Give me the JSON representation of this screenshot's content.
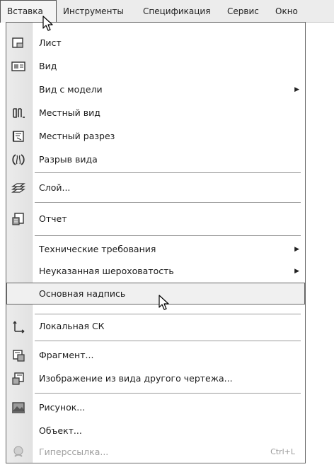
{
  "menubar": {
    "items": [
      {
        "label": "Вставка"
      },
      {
        "label": "Инструменты"
      },
      {
        "label": "Спецификация"
      },
      {
        "label": "Сервис"
      },
      {
        "label": "Окно"
      }
    ]
  },
  "menu": {
    "items": [
      {
        "label": "Лист",
        "icon": "sheet-icon"
      },
      {
        "label": "Вид",
        "icon": "view-icon"
      },
      {
        "label": "Вид с модели",
        "submenu": true
      },
      {
        "label": "Местный вид",
        "icon": "local-view-icon"
      },
      {
        "label": "Местный разрез",
        "icon": "local-section-icon"
      },
      {
        "label": "Разрыв вида",
        "icon": "view-break-icon"
      },
      {
        "label": "Слой...",
        "icon": "layer-icon"
      },
      {
        "label": "Отчет",
        "icon": "report-icon"
      },
      {
        "label": "Технические требования",
        "submenu": true
      },
      {
        "label": "Неуказанная шероховатость",
        "submenu": true
      },
      {
        "label": "Основная надпись"
      },
      {
        "label": "Локальная СК",
        "icon": "local-cs-icon"
      },
      {
        "label": "Фрагмент...",
        "icon": "fragment-icon"
      },
      {
        "label": "Изображение из вида другого чертежа...",
        "icon": "image-from-view-icon"
      },
      {
        "label": "Рисунок...",
        "icon": "picture-icon"
      },
      {
        "label": "Объект..."
      },
      {
        "label": "Гиперссылка...",
        "icon": "hyperlink-icon",
        "shortcut": "Ctrl+L",
        "disabled": true
      }
    ]
  }
}
